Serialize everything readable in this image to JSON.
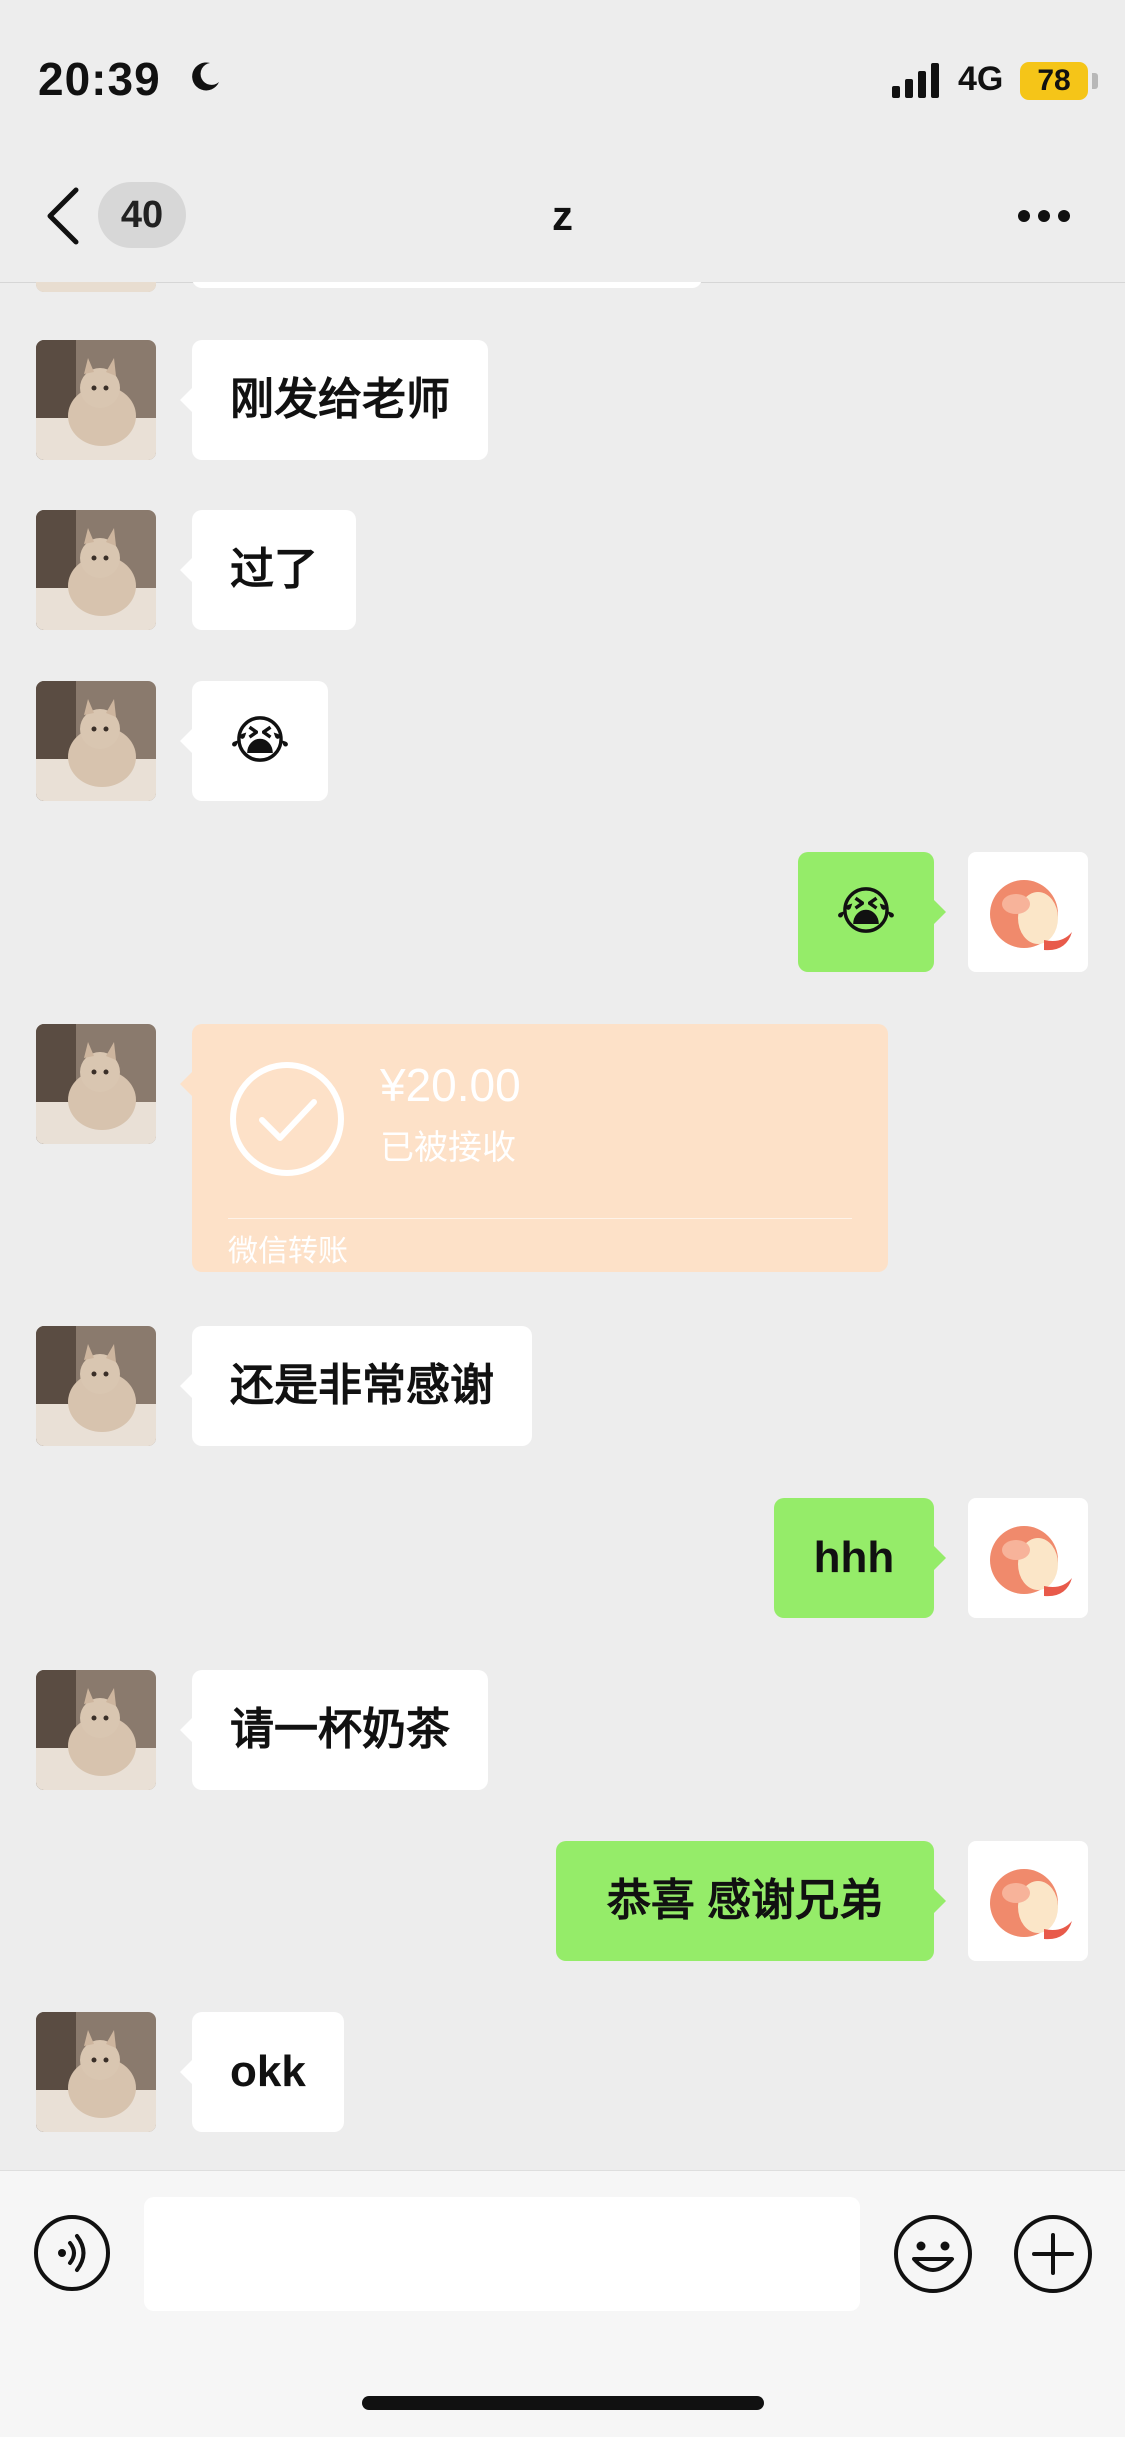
{
  "status_bar": {
    "time": "20:39",
    "network": "4G",
    "battery": "78",
    "moon_icon": "moon-icon"
  },
  "nav": {
    "unread_count": "40",
    "title": "z",
    "back_icon": "chevron-left-icon",
    "more_icon": "more-icon"
  },
  "messages": [
    {
      "side": "in",
      "text": "刚发给老师"
    },
    {
      "side": "in",
      "text": "过了"
    },
    {
      "side": "in",
      "text": "😭"
    },
    {
      "side": "out",
      "text": "😭"
    },
    {
      "side": "in",
      "type": "transfer",
      "amount": "¥20.00",
      "status": "已被接收",
      "source": "微信转账"
    },
    {
      "side": "in",
      "text": "还是非常感谢"
    },
    {
      "side": "out",
      "text": "hhh"
    },
    {
      "side": "in",
      "text": "请一杯奶茶"
    },
    {
      "side": "out",
      "text": "恭喜 感谢兄弟"
    },
    {
      "side": "in",
      "text": "okk"
    }
  ],
  "colors": {
    "outgoing_bubble": "#95ec69",
    "incoming_bubble": "#ffffff",
    "transfer_card": "#fde1c8",
    "battery": "#f5c518"
  },
  "input_bar": {
    "voice_icon": "voice-icon",
    "emoji_icon": "emoji-icon",
    "plus_icon": "plus-icon"
  }
}
